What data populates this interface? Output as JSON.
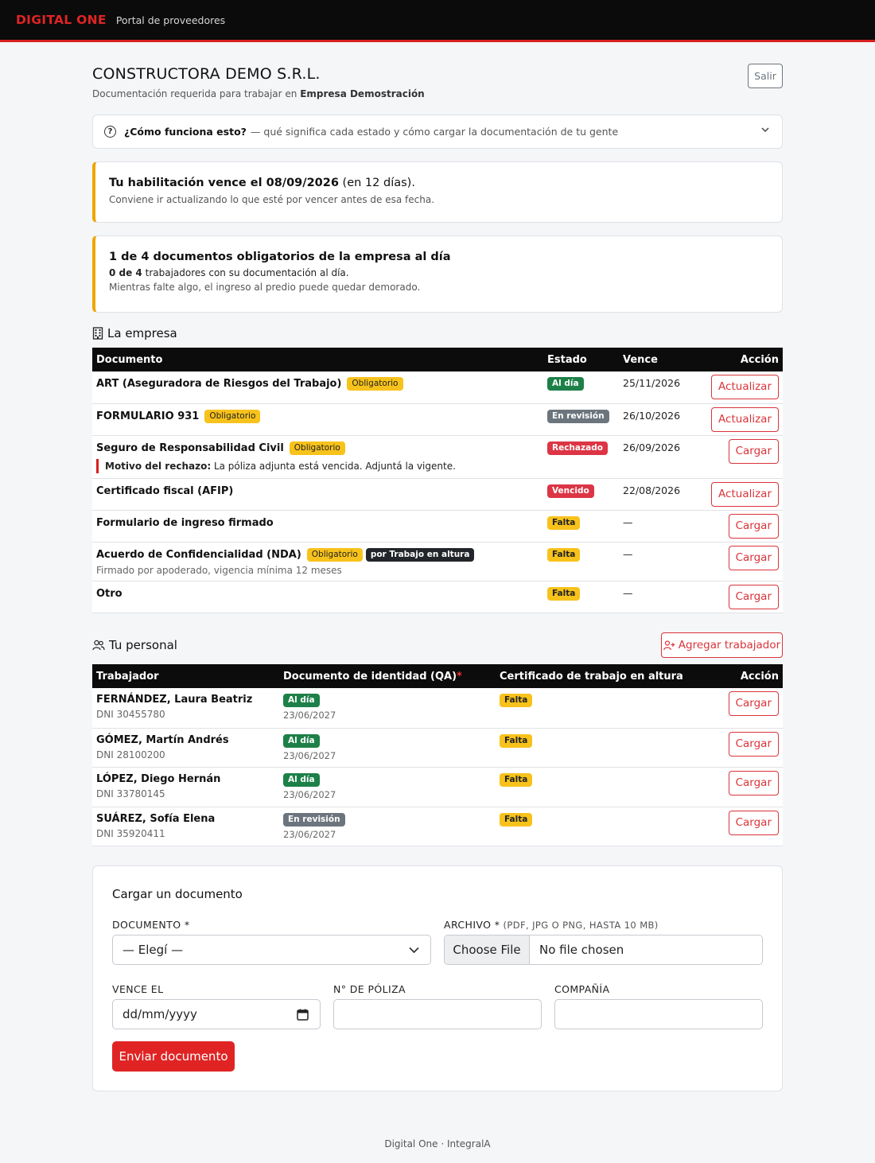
{
  "navbar": {
    "brand": "DIGITAL ONE",
    "subtitle": "Portal de proveedores"
  },
  "header": {
    "company": "CONSTRUCTORA DEMO S.R.L.",
    "subtitle_prefix": "Documentación requerida para trabajar en ",
    "subtitle_client": "Empresa Demostración",
    "logout_label": "Salir"
  },
  "help": {
    "icon": "question-circle-icon",
    "question": "¿Cómo funciona esto?",
    "rest": "— qué significa cada estado y cómo cargar la documentación de tu gente"
  },
  "alert_expiry": {
    "title_bold": "Tu habilitación vence el 08/09/2026",
    "title_rest": " (en 12 días).",
    "text": "Conviene ir actualizando lo que esté por vencer antes de esa fecha."
  },
  "alert_status": {
    "title": "1 de 4 documentos obligatorios de la empresa al día",
    "workers_bold": "0 de 4",
    "workers_rest": " trabajadores con su documentación al día.",
    "note": "Mientras falte algo, el ingreso al predio puede quedar demorado."
  },
  "company_section": {
    "title": "La empresa",
    "icon": "building-icon",
    "columns": [
      "Documento",
      "Estado",
      "Vence",
      "Acción"
    ],
    "rows": [
      {
        "name": "ART (Aseguradora de Riesgos del Trabajo)",
        "obligatorio": "Obligatorio",
        "status": "Al día",
        "status_type": "ok",
        "expires": "25/11/2026",
        "action": "Actualizar"
      },
      {
        "name": "FORMULARIO 931",
        "obligatorio": "Obligatorio",
        "status": "En revisión",
        "status_type": "rev",
        "expires": "26/10/2026",
        "action": "Actualizar"
      },
      {
        "name": "Seguro de Responsabilidad Civil",
        "obligatorio": "Obligatorio",
        "status": "Rechazado",
        "status_type": "rej",
        "expires": "26/09/2026",
        "action": "Cargar",
        "reject_label": "Motivo del rechazo:",
        "reject_text": " La póliza adjunta está vencida. Adjuntá la vigente."
      },
      {
        "name": "Certificado fiscal (AFIP)",
        "status": "Vencido",
        "status_type": "rej",
        "expires": "22/08/2026",
        "action": "Actualizar"
      },
      {
        "name": "Formulario de ingreso firmado",
        "status": "Falta",
        "status_type": "warn",
        "expires": "—",
        "action": "Cargar"
      },
      {
        "name": "Acuerdo de Confidencialidad (NDA)",
        "obligatorio": "Obligatorio",
        "tag": "por Trabajo en altura",
        "note": "Firmado por apoderado, vigencia mínima 12 meses",
        "status": "Falta",
        "status_type": "warn",
        "expires": "—",
        "action": "Cargar"
      },
      {
        "name": "Otro",
        "status": "Falta",
        "status_type": "warn",
        "expires": "—",
        "action": "Cargar"
      }
    ]
  },
  "staff_section": {
    "title": "Tu personal",
    "icon": "people-icon",
    "add_label": "Agregar trabajador",
    "columns": [
      "Trabajador",
      "Documento de identidad (QA)",
      "Certificado de trabajo en altura",
      "Acción"
    ],
    "required_mark": "*",
    "rows": [
      {
        "name": "FERNÁNDEZ, Laura Beatriz",
        "dni": "DNI 30455780",
        "id_status": "Al día",
        "id_type": "ok",
        "id_date": "23/06/2027",
        "cert_status": "Falta",
        "action": "Cargar"
      },
      {
        "name": "GÓMEZ, Martín Andrés",
        "dni": "DNI 28100200",
        "id_status": "Al día",
        "id_type": "ok",
        "id_date": "23/06/2027",
        "cert_status": "Falta",
        "action": "Cargar"
      },
      {
        "name": "LÓPEZ, Diego Hernán",
        "dni": "DNI 33780145",
        "id_status": "Al día",
        "id_type": "ok",
        "id_date": "23/06/2027",
        "cert_status": "Falta",
        "action": "Cargar"
      },
      {
        "name": "SUÁREZ, Sofía Elena",
        "dni": "DNI 35920411",
        "id_status": "En revisión",
        "id_type": "rev",
        "id_date": "23/06/2027",
        "cert_status": "Falta",
        "action": "Cargar"
      }
    ]
  },
  "upload_form": {
    "title": "Cargar un documento",
    "document_label": "DOCUMENTO *",
    "document_value": "— Elegí —",
    "file_label": "ARCHIVO *",
    "file_hint": " (PDF, JPG O PNG, HASTA 10 MB)",
    "file_button": "Choose File",
    "file_value": "No file chosen",
    "expires_label": "VENCE EL",
    "expires_placeholder": "dd/mm/yyyy",
    "policy_label": "N° DE PÓLIZA",
    "company_label": "COMPAÑÍA",
    "submit_label": "Enviar documento"
  },
  "footer": {
    "text": "Digital One · IntegralA"
  }
}
